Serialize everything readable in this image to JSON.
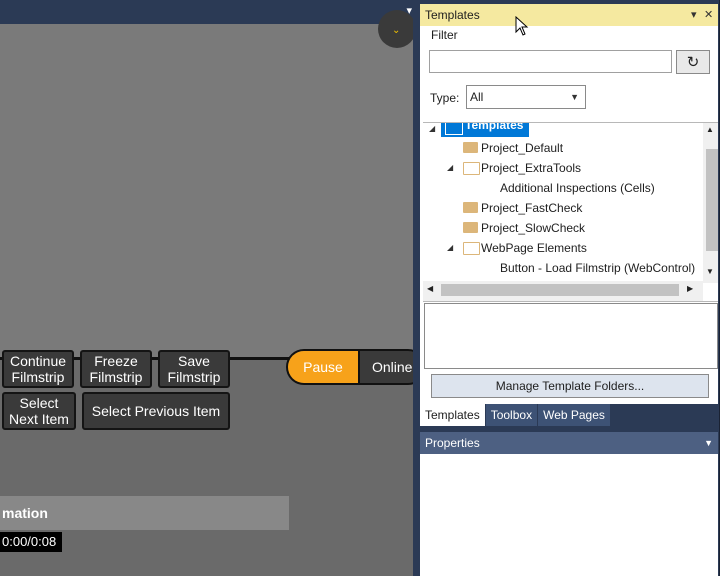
{
  "left": {
    "buttons": {
      "continue": "Continue\nFilmstrip",
      "freeze": "Freeze\nFilmstrip",
      "save": "Save\nFilmstrip",
      "select_next": "Select\nNext Item",
      "select_previous": "Select Previous Item"
    },
    "mode": {
      "pause": "Pause",
      "online": "Online"
    },
    "info_title": "mation",
    "timecode": "0:00/0:08"
  },
  "templates": {
    "title": "Templates",
    "filter_label": "Filter",
    "filter_value": "",
    "type_label": "Type:",
    "type_value": "All",
    "tree": {
      "root": "Templates",
      "items": [
        {
          "label": "Project_Default"
        },
        {
          "label": "Project_ExtraTools"
        },
        {
          "label": "Additional Inspections  (Cells)"
        },
        {
          "label": "Project_FastCheck"
        },
        {
          "label": "Project_SlowCheck"
        },
        {
          "label": "WebPage Elements"
        },
        {
          "label": "Button - Load Filmstrip  (WebControl)"
        }
      ]
    },
    "manage_button": "Manage Template Folders...",
    "tabs": [
      "Templates",
      "Toolbox",
      "Web Pages"
    ]
  },
  "properties": {
    "title": "Properties"
  }
}
